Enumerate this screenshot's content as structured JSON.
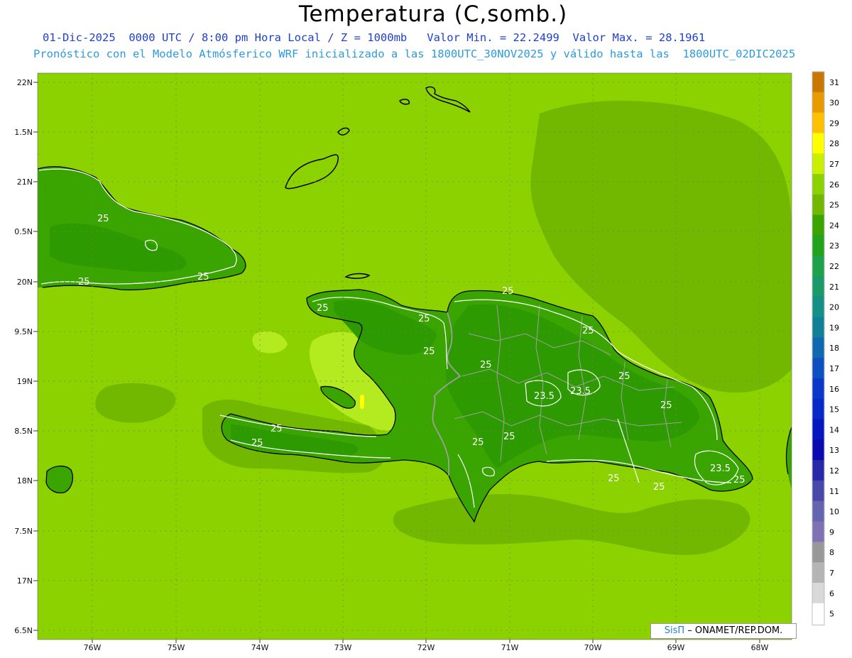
{
  "header": {
    "title": "Temperatura (C,somb.)",
    "subtitle_line1": "01-Dic-2025  0000 UTC / 8:00 pm Hora Local / Z = 1000mb   Valor Min. = 22.2499  Valor Max. = 28.1961",
    "subtitle_line2": "Pronóstico con el Modelo Atmósferico WRF inicializado a las 1800UTC_30NOV2025 y válido hasta las  1800UTC_02DIC2025"
  },
  "map": {
    "lon_labels": [
      "76W",
      "75W",
      "74W",
      "73W",
      "72W",
      "71W",
      "70W",
      "69W",
      "68W"
    ],
    "lat_labels": [
      "22N",
      "1.5N",
      "21N",
      "0.5N",
      "20N",
      "9.5N",
      "19N",
      "8.5N",
      "18N",
      "7.5N",
      "17N",
      "6.5N"
    ],
    "contour_labels": [
      "25",
      "25",
      "25",
      "25",
      "25",
      "25",
      "25",
      "25",
      "25",
      "23.5",
      "23.5",
      "25",
      "25",
      "25",
      "25",
      "25",
      "23.5",
      "25",
      "25",
      "25",
      "25"
    ],
    "colors": {
      "sea": "#8cd200",
      "warm_sea": "#b3ea20",
      "hot_spot": "#ffff00",
      "cool_sea": "#73b800",
      "land": "#3aa400",
      "land_cool": "#2c9a00",
      "coast": "#000000",
      "border": "#a0a0a0",
      "contour": "#ffffff"
    }
  },
  "colorbar": {
    "labels": [
      "31",
      "30",
      "29",
      "28",
      "27",
      "26",
      "25",
      "24",
      "23",
      "22",
      "21",
      "20",
      "19",
      "18",
      "17",
      "16",
      "15",
      "14",
      "13",
      "12",
      "11",
      "10",
      "9",
      "8",
      "7",
      "6",
      "5"
    ],
    "colors": [
      "#c87800",
      "#e89a00",
      "#ffc000",
      "#ffff00",
      "#c8f000",
      "#8cd200",
      "#73b800",
      "#3aa400",
      "#23a21c",
      "#1fa04a",
      "#1a9a68",
      "#159084",
      "#127f98",
      "#1068b0",
      "#0d50c0",
      "#0a38c8",
      "#0828c8",
      "#0616c0",
      "#0a0ab0",
      "#2828a8",
      "#4848a8",
      "#6464b0",
      "#8070b4",
      "#989898",
      "#b4b4b4",
      "#d8d8d8",
      "#ffffff"
    ]
  },
  "credit": {
    "brand": "SisΠ",
    "text": "– ONAMET/REP.DOM."
  }
}
